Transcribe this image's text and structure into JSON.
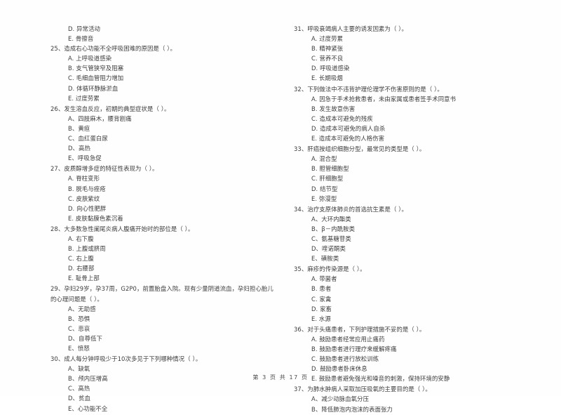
{
  "document": {
    "type": "scanned-exam-paper",
    "footer": "第 3 页 共 17 页"
  },
  "left_column": {
    "orphan_options": [
      "D. 异常活动",
      "E. 骨擦音"
    ],
    "questions": [
      {
        "number": "25、",
        "stem": "造成右心功能不全呼吸困难的原因是（      ）。",
        "options": [
          "A. 上呼吸道感染",
          "B. 支气管狭窄及阻塞",
          "C. 毛细血管阻力增加",
          "D. 体循环静脉淤血",
          "E. 过度劳累"
        ]
      },
      {
        "number": "26、",
        "stem": "发生溶血反应，初期的典型症状是（      ）。",
        "options": [
          "A、四肢麻木，腰背剧痛",
          "B、黄疸",
          "C、血红蛋白尿",
          "D、高热",
          "E、呼吸急促"
        ]
      },
      {
        "number": "27、",
        "stem": "皮质醇增多症的特征性表现为（      ）。",
        "options": [
          "A. 脊柱变形",
          "B. 脱毛与痤疮",
          "C. 皮肤紫纹",
          "D. 向心性肥胖",
          "E. 皮肤黏膜色素沉着"
        ]
      },
      {
        "number": "28、",
        "stem": "大多数急性阑尾炎病人腹痛开始时的部位是（      ）。",
        "options": [
          "A. 右下腹",
          "B. 上腹或脐周",
          "C. 右上腹",
          "D. 右腰部",
          "E. 耻骨上部"
        ]
      },
      {
        "number": "29、",
        "stem": "孕妇29岁，孕37周，G2P0，前置胎盘入院。现有少量阴道流血，孕妇担心胎儿",
        "stem_line2": "的心理问题是（      ）。",
        "options": [
          "A、无助感",
          "B、恐惧",
          "C、悲哀",
          "D、自尊低下",
          "E、愤怒"
        ]
      },
      {
        "number": "30、",
        "stem": "成人每分钟呼吸少于10次多见于下列哪种情况（      ）。",
        "options": [
          "A、缺氧",
          "B、颅内压增高",
          "C、高热",
          "D、贫血",
          "E、心功能不全"
        ]
      }
    ]
  },
  "right_column": {
    "questions": [
      {
        "number": "31、",
        "stem": "呼吸衰竭病人主要的诱发因素为（      ）。",
        "options": [
          "A. 过度劳累",
          "B. 精神紧张",
          "C. 营养不良",
          "D. 呼吸道感染",
          "E. 长期吸烟"
        ]
      },
      {
        "number": "32、",
        "stem": "下列做法中不违背护理伦理学不伤害原则的是（      ）。",
        "options": [
          "A. 因急于手术抢救患者，未由家属或患者签手术同意书",
          "B. 发生故意伤害",
          "C. 造成本可避免的残疾",
          "D. 造成本可避免的病人自杀",
          "E. 造成本可避免的人格伤害"
        ]
      },
      {
        "number": "33、",
        "stem": "肝癌按组织细胞分型，最常见的类型是（      ）。",
        "options": [
          "A. 混合型",
          "B. 胆管细胞型",
          "C. 肝细胞型",
          "D. 结节型",
          "E. 弥漫型"
        ]
      },
      {
        "number": "34、",
        "stem": "治疗支原体肺炎的首选抗生素是（      ）。",
        "options": [
          "A、大环内酯类",
          "B、β－内酰胺类",
          "C、氨基糖苷类",
          "D、喹诺酮类",
          "E、磺胺类"
        ]
      },
      {
        "number": "35、",
        "stem": "麻疹的传染源是（      ）。",
        "options": [
          "A. 带菌者",
          "B. 患者",
          "C. 家禽",
          "D. 家畜",
          "E. 水源"
        ]
      },
      {
        "number": "36、",
        "stem": "对于头痛患者，下列护理措施不妥的是（      ）。",
        "options": [
          "A. 鼓励患者经常应用止痛药",
          "B. 鼓励患者进行理疗来缓解疼痛",
          "C. 鼓励患者进行放松训练",
          "D. 鼓励患者卧床休息",
          "E. 鼓励患者避免强光和噪音的刺激，保持环境的安静"
        ]
      },
      {
        "number": "37、",
        "stem": "为肺水肿病人采取加压吸氧的主要目的是（      ）。",
        "options": [
          "A、减少动脉血氧分压",
          "B、降低肺泡内泡沫的表面张力"
        ]
      }
    ]
  }
}
